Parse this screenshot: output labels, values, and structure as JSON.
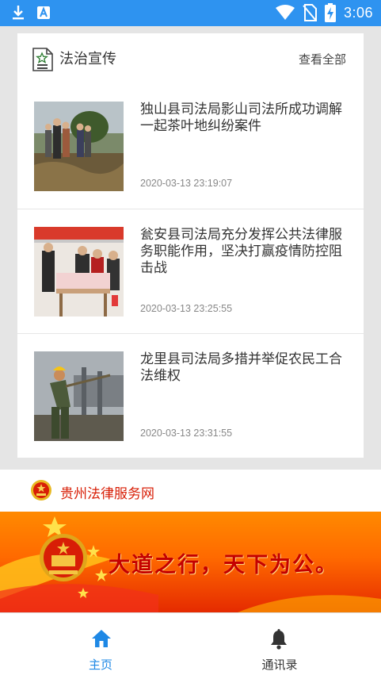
{
  "status_bar": {
    "time": "3:06",
    "icons": [
      "download-icon",
      "app-a-icon",
      "wifi-icon",
      "no-sim-icon",
      "battery-charging-icon"
    ],
    "background": "#2e93f0"
  },
  "section": {
    "title": "法治宣传",
    "view_all": "查看全部"
  },
  "news": [
    {
      "title": "独山县司法局影山司法所成功调解一起茶叶地纠纷案件",
      "time": "2020-03-13 23:19:07"
    },
    {
      "title": "瓮安县司法局充分发挥公共法律服务职能作用，坚决打赢疫情防控阻击战",
      "time": "2020-03-13 23:25:55"
    },
    {
      "title": "龙里县司法局多措并举促农民工合法维权",
      "time": "2020-03-13 23:31:55"
    }
  ],
  "gz_link": {
    "label": "贵州法律服务网",
    "color": "#d81e06"
  },
  "banner": {
    "slogan": "大道之行，天下为公。"
  },
  "bottom_nav": {
    "home": {
      "label": "主页",
      "icon": "home-icon",
      "color": "#1e88e5"
    },
    "contacts": {
      "label": "通讯录",
      "icon": "bell-icon"
    }
  }
}
